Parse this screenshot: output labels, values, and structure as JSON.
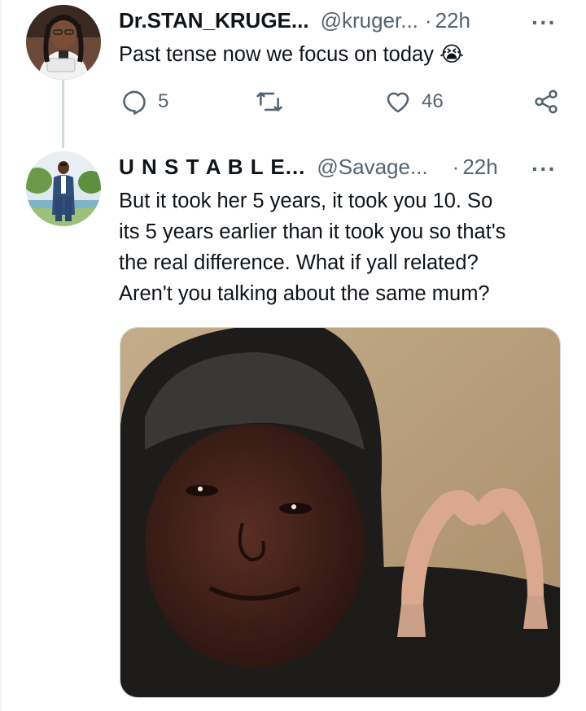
{
  "tweets": [
    {
      "name": "Dr.STAN_KRUGE...",
      "handle": "@kruger...",
      "dot": "·",
      "time": "22h",
      "more": "···",
      "text_lines": [
        "Past tense now we focus on today 😭"
      ],
      "actions": {
        "reply_icon": "reply-icon",
        "reply_count": "5",
        "retweet_icon": "retweet-icon",
        "like_icon": "heart-icon",
        "like_count": "46",
        "share_icon": "share-icon"
      }
    },
    {
      "name": "U N S T A B L E...",
      "handle": "@Savage...",
      "dot": "·",
      "time": "22h",
      "more": "···",
      "text_lines": [
        "But it took her 5 years, it took you 10. So",
        "its 5 years earlier than it took you so that's",
        "the real difference. What if yall related?",
        "Aren't you talking about the same mum?"
      ]
    }
  ],
  "colors": {
    "text": "#0f1419",
    "secondary": "#536471",
    "thread_line": "#cfd9de"
  }
}
